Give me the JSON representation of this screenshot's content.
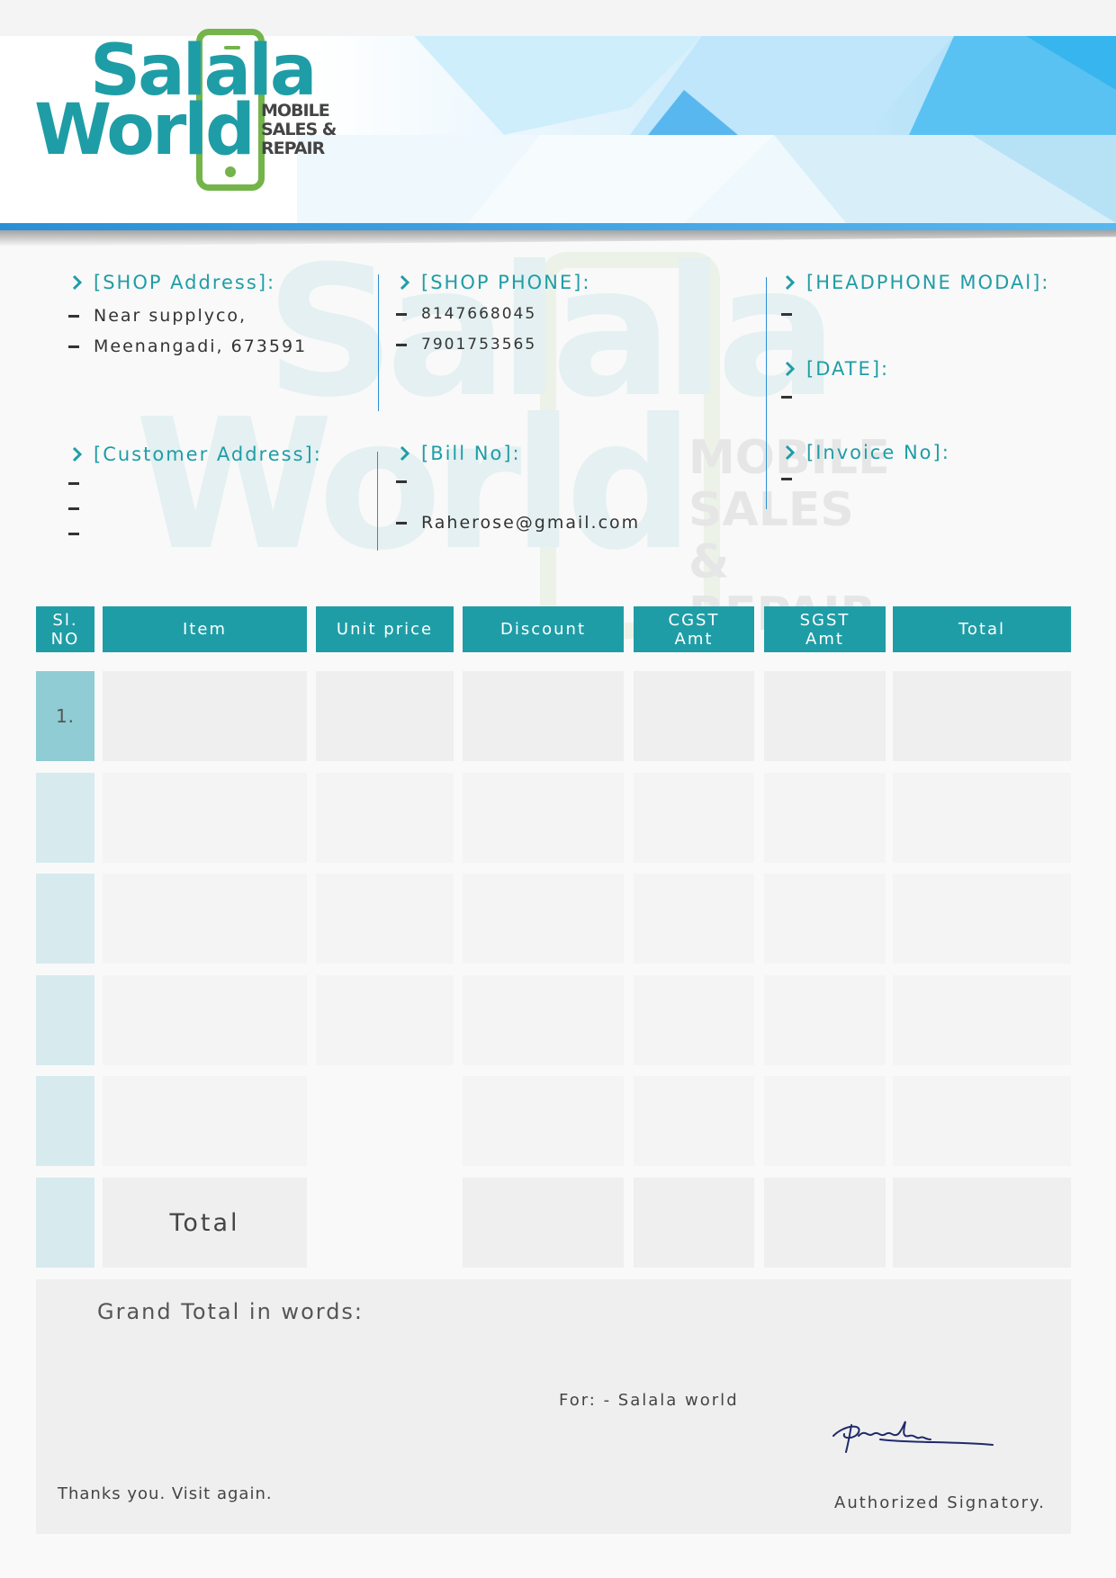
{
  "logo": {
    "line1": "Salala",
    "line2": "World",
    "tagline": [
      "MOBILE",
      "SALES &",
      "REPAIR"
    ]
  },
  "info": {
    "shop_address": {
      "heading": "[SHOP Address]:",
      "lines": [
        "Near supplyco,",
        "Meenangadi, 673591"
      ]
    },
    "shop_phone": {
      "heading": "[SHOP PHONE]:",
      "lines": [
        "8147668045",
        "7901753565"
      ]
    },
    "headphone_model": {
      "heading": "[HEADPHONE MODAl]:"
    },
    "date": {
      "heading": "[DATE]:"
    },
    "customer_address": {
      "heading": "[Customer Address]:"
    },
    "bill_no": {
      "heading": "[Bill No]:",
      "email": "Raherose@gmail.com"
    },
    "invoice_no": {
      "heading": "[Invoice No]:"
    }
  },
  "table": {
    "headers": {
      "sl_no": [
        "Sl.",
        "NO"
      ],
      "item": "Item",
      "unit_price": "Unit price",
      "discount": "Discount",
      "cgst": [
        "CGST",
        "Amt"
      ],
      "sgst": [
        "SGST",
        "Amt"
      ],
      "total": "Total"
    },
    "rows": [
      {
        "sl": "1."
      },
      {
        "sl": ""
      },
      {
        "sl": ""
      },
      {
        "sl": ""
      },
      {
        "sl": ""
      }
    ],
    "total_label": "Total"
  },
  "footer": {
    "grand_total_label": "Grand Total in words:",
    "for_label": "For:   -  Salala world",
    "thanks": "Thanks you. Visit again.",
    "authorized": "Authorized Signatory."
  },
  "colors": {
    "teal": "#1f9da6",
    "green": "#74b44a",
    "blue": "#2a8fd6"
  }
}
